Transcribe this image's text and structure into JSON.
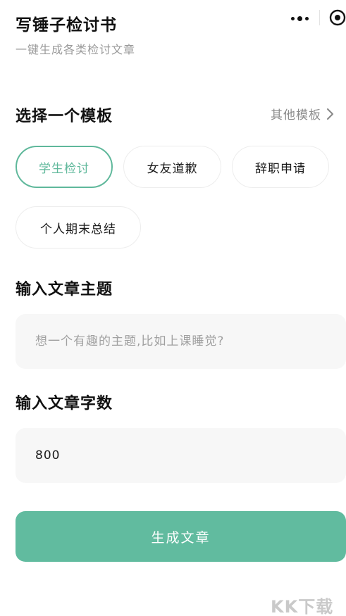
{
  "header": {
    "title": "写锤子检讨书",
    "subtitle": "一键生成各类检讨文章"
  },
  "capsule": {
    "more_icon": "more-dots-icon",
    "close_icon": "target-close-icon"
  },
  "template_section": {
    "title": "选择一个模板",
    "more_label": "其他模板",
    "more_icon": "chevron-right-icon",
    "chips": [
      {
        "label": "学生检讨",
        "selected": true
      },
      {
        "label": "女友道歉",
        "selected": false
      },
      {
        "label": "辞职申请",
        "selected": false
      },
      {
        "label": "个人期末总结",
        "selected": false
      }
    ]
  },
  "topic_section": {
    "title": "输入文章主题",
    "placeholder": "想一个有趣的主题,比如上课睡觉?",
    "value": ""
  },
  "wordcount_section": {
    "title": "输入文章字数",
    "value": "800"
  },
  "actions": {
    "generate_label": "生成文章"
  },
  "colors": {
    "accent": "#61bb9f",
    "chip_selected": "#5fb89b",
    "field_bg": "#f7f7f7"
  },
  "watermark": "KK下载"
}
